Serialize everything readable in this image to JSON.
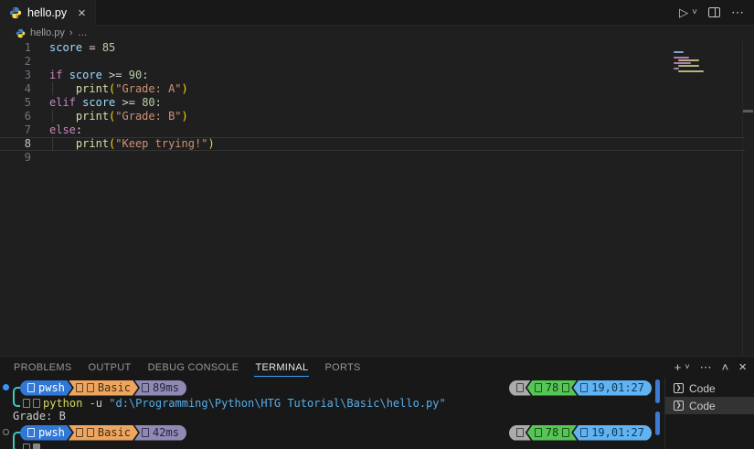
{
  "tab_bar": {
    "tab": {
      "label": "hello.py",
      "close_glyph": "×"
    },
    "actions": {
      "run_glyph": "▷",
      "caret_glyph": "˅",
      "more_glyph": "⋯"
    }
  },
  "breadcrumb": {
    "file": "hello.py",
    "separator": "›",
    "ellipsis": "…"
  },
  "editor": {
    "lines": [
      {
        "n": "1",
        "tokens": [
          [
            "var",
            "score"
          ],
          [
            "plain",
            " "
          ],
          [
            "op",
            "="
          ],
          [
            "plain",
            " "
          ],
          [
            "num",
            "85"
          ]
        ]
      },
      {
        "n": "2",
        "tokens": []
      },
      {
        "n": "3",
        "tokens": [
          [
            "kw",
            "if"
          ],
          [
            "plain",
            " "
          ],
          [
            "var",
            "score"
          ],
          [
            "plain",
            " "
          ],
          [
            "op",
            ">="
          ],
          [
            "plain",
            " "
          ],
          [
            "num",
            "90"
          ],
          [
            "op",
            ":"
          ]
        ]
      },
      {
        "n": "4",
        "tokens": [
          [
            "guide",
            "│"
          ],
          [
            "plain",
            "   "
          ],
          [
            "fn",
            "print"
          ],
          [
            "brk",
            "("
          ],
          [
            "str",
            "\"Grade: A\""
          ],
          [
            "brk",
            ")"
          ]
        ]
      },
      {
        "n": "5",
        "tokens": [
          [
            "kw",
            "elif"
          ],
          [
            "plain",
            " "
          ],
          [
            "var",
            "score"
          ],
          [
            "plain",
            " "
          ],
          [
            "op",
            ">="
          ],
          [
            "plain",
            " "
          ],
          [
            "num",
            "80"
          ],
          [
            "op",
            ":"
          ]
        ]
      },
      {
        "n": "6",
        "tokens": [
          [
            "guide",
            "│"
          ],
          [
            "plain",
            "   "
          ],
          [
            "fn",
            "print"
          ],
          [
            "brk",
            "("
          ],
          [
            "str",
            "\"Grade: B\""
          ],
          [
            "brk",
            ")"
          ]
        ]
      },
      {
        "n": "7",
        "tokens": [
          [
            "kw",
            "else"
          ],
          [
            "op",
            ":"
          ]
        ]
      },
      {
        "n": "8",
        "current": true,
        "tokens": [
          [
            "guide",
            "│"
          ],
          [
            "plain",
            "   "
          ],
          [
            "fn",
            "print"
          ],
          [
            "brk",
            "("
          ],
          [
            "str",
            "\"Keep trying!\""
          ],
          [
            "brk",
            ")"
          ]
        ]
      },
      {
        "n": "9",
        "tokens": []
      }
    ]
  },
  "panel": {
    "tabs": [
      {
        "label": "PROBLEMS"
      },
      {
        "label": "OUTPUT"
      },
      {
        "label": "DEBUG CONSOLE"
      },
      {
        "label": "TERMINAL",
        "active": true
      },
      {
        "label": "PORTS"
      }
    ],
    "toolbar": [
      {
        "name": "new-terminal-button",
        "glyph": "+"
      },
      {
        "name": "launch-profile-dropdown-icon",
        "glyph": "˅",
        "small": true
      },
      {
        "name": "terminal-more-actions-icon",
        "glyph": "⋯"
      },
      {
        "name": "maximize-panel-icon",
        "glyph": "˄"
      },
      {
        "name": "close-panel-icon",
        "glyph": "×",
        "x": true
      }
    ]
  },
  "terminal": {
    "colors": {
      "pwsh_bg": "#3178d6",
      "pwsh_fg": "#ffffff",
      "basic_bg": "#eea55f",
      "basic_fg": "#3f2f14",
      "time_bg": "#8f8ab5",
      "time_fg": "#26243a",
      "gray_bg": "#ababab",
      "gray_fg": "#2e2e2e",
      "green_bg": "#56c556",
      "green_fg": "#0f3d0f",
      "blue_bg": "#61b3f2",
      "blue_fg": "#0e3756",
      "connector": "#3fc6bd",
      "decoration_success": "#3794ff"
    },
    "commands": [
      {
        "marker": "filled",
        "left": [
          {
            "key": "pwsh",
            "label": "pwsh",
            "tofus": 1
          },
          {
            "key": "basic",
            "label": "Basic",
            "tofus": 2
          },
          {
            "key": "time",
            "label": "89ms",
            "tofus": 1
          }
        ],
        "right": [
          {
            "key": "gray",
            "label": "",
            "tofus": 1
          },
          {
            "key": "green",
            "label": "78",
            "tofus": 1,
            "tofu_after": 1
          },
          {
            "key": "blue",
            "label": "19,01:27",
            "tofus": 1
          }
        ],
        "command": [
          [
            "cmd",
            "python"
          ],
          [
            "plain",
            " -u "
          ],
          [
            "path",
            "\"d:\\Programming\\Python\\HTG Tutorial\\Basic\\hello.py\""
          ]
        ],
        "output": "Grade: B"
      },
      {
        "marker": "ring",
        "left": [
          {
            "key": "pwsh",
            "label": "pwsh",
            "tofus": 1
          },
          {
            "key": "basic",
            "label": "Basic",
            "tofus": 2
          },
          {
            "key": "time",
            "label": "42ms",
            "tofus": 1
          }
        ],
        "right": [
          {
            "key": "gray",
            "label": "",
            "tofus": 1
          },
          {
            "key": "green",
            "label": "78",
            "tofus": 1,
            "tofu_after": 1
          },
          {
            "key": "blue",
            "label": "19,01:27",
            "tofus": 1
          }
        ],
        "command": null,
        "cursor": true
      }
    ]
  },
  "terminal_list": {
    "items": [
      {
        "label": "Code"
      },
      {
        "label": "Code",
        "selected": true
      }
    ]
  }
}
